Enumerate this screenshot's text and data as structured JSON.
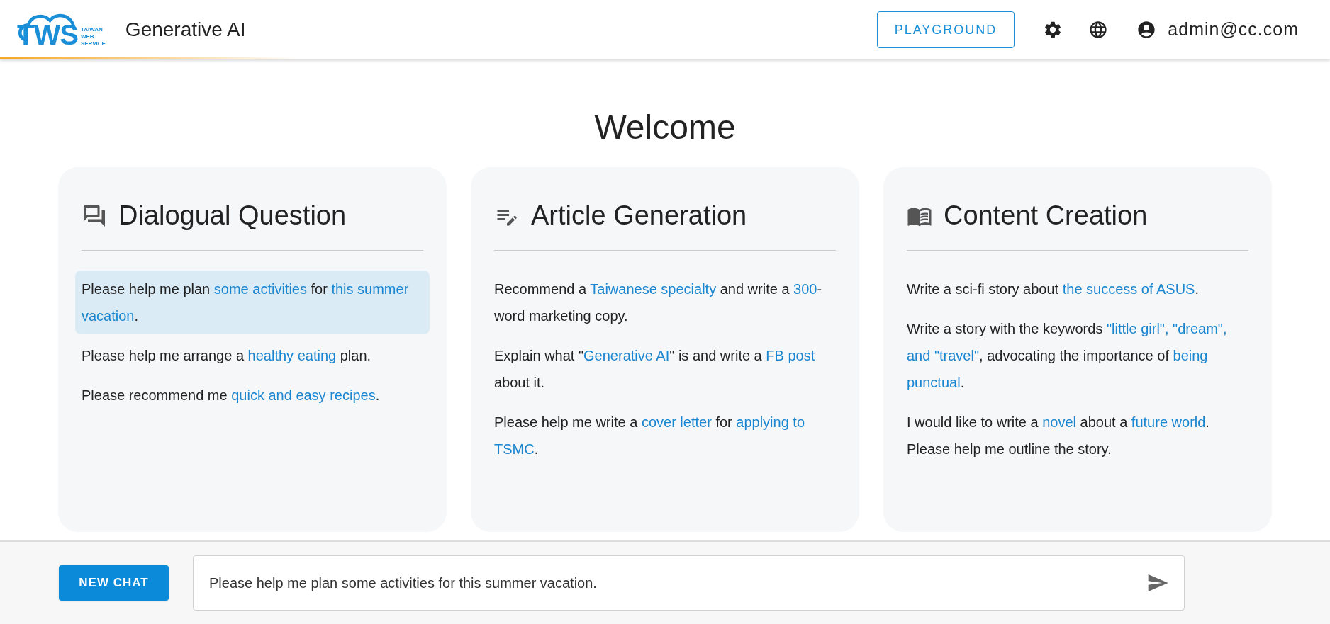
{
  "header": {
    "logo": {
      "letters": "TWS",
      "tagline": [
        "TAIWAN",
        "WEB",
        "SERVICE"
      ]
    },
    "title": "Generative AI",
    "playground_button": "PLAYGROUND",
    "user": "admin@cc.com"
  },
  "welcome": "Welcome",
  "cards": [
    {
      "kind": "dialog",
      "title": "Dialogual Question",
      "prompts": [
        {
          "selected": true,
          "segments": [
            {
              "text": "Please help me plan ",
              "highlight": false
            },
            {
              "text": "some activities",
              "highlight": true
            },
            {
              "text": " for ",
              "highlight": false
            },
            {
              "text": "this summer vacation",
              "highlight": true
            },
            {
              "text": ".",
              "highlight": false
            }
          ]
        },
        {
          "selected": false,
          "segments": [
            {
              "text": "Please help me arrange a ",
              "highlight": false
            },
            {
              "text": "healthy eating",
              "highlight": true
            },
            {
              "text": " plan.",
              "highlight": false
            }
          ]
        },
        {
          "selected": false,
          "segments": [
            {
              "text": "Please recommend me ",
              "highlight": false
            },
            {
              "text": "quick and easy recipes",
              "highlight": true
            },
            {
              "text": ".",
              "highlight": false
            }
          ]
        }
      ]
    },
    {
      "kind": "article",
      "title": "Article Generation",
      "prompts": [
        {
          "selected": false,
          "segments": [
            {
              "text": "Recommend a ",
              "highlight": false
            },
            {
              "text": "Taiwanese specialty",
              "highlight": true
            },
            {
              "text": " and write a ",
              "highlight": false
            },
            {
              "text": "300",
              "highlight": true
            },
            {
              "text": "-word marketing copy.",
              "highlight": false
            }
          ]
        },
        {
          "selected": false,
          "segments": [
            {
              "text": "Explain what \"",
              "highlight": false
            },
            {
              "text": "Generative AI",
              "highlight": true
            },
            {
              "text": "\" is and write a ",
              "highlight": false
            },
            {
              "text": "FB post",
              "highlight": true
            },
            {
              "text": " about it.",
              "highlight": false
            }
          ]
        },
        {
          "selected": false,
          "segments": [
            {
              "text": "Please help me write a ",
              "highlight": false
            },
            {
              "text": "cover letter",
              "highlight": true
            },
            {
              "text": " for ",
              "highlight": false
            },
            {
              "text": "applying to TSMC",
              "highlight": true
            },
            {
              "text": ".",
              "highlight": false
            }
          ]
        }
      ]
    },
    {
      "kind": "content",
      "title": "Content Creation",
      "prompts": [
        {
          "selected": false,
          "segments": [
            {
              "text": "Write a sci-fi story about ",
              "highlight": false
            },
            {
              "text": "the success of ASUS",
              "highlight": true
            },
            {
              "text": ".",
              "highlight": false
            }
          ]
        },
        {
          "selected": false,
          "segments": [
            {
              "text": "Write a story with the keywords ",
              "highlight": false
            },
            {
              "text": "\"little girl\", \"dream\", and \"travel\"",
              "highlight": true
            },
            {
              "text": ", advocating the importance of ",
              "highlight": false
            },
            {
              "text": "being punctual",
              "highlight": true
            },
            {
              "text": ".",
              "highlight": false
            }
          ]
        },
        {
          "selected": false,
          "segments": [
            {
              "text": "I would like to write a ",
              "highlight": false
            },
            {
              "text": "novel",
              "highlight": true
            },
            {
              "text": " about a ",
              "highlight": false
            },
            {
              "text": "future world",
              "highlight": true
            },
            {
              "text": ". Please help me outline the story.",
              "highlight": false
            }
          ]
        }
      ]
    }
  ],
  "footer": {
    "new_chat_button": "NEW CHAT",
    "message": {
      "value": "Please help me plan some activities for this summer vacation."
    }
  }
}
